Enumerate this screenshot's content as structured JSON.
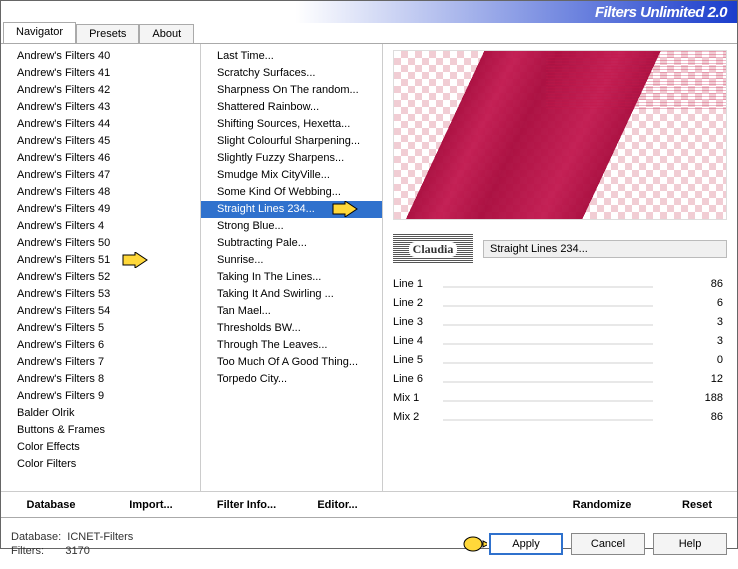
{
  "title": "Filters Unlimited 2.0",
  "tabs": [
    "Navigator",
    "Presets",
    "About"
  ],
  "active_tab": 0,
  "categories": [
    "Andrew's Filters 40",
    "Andrew's Filters 41",
    "Andrew's Filters 42",
    "Andrew's Filters 43",
    "Andrew's Filters 44",
    "Andrew's Filters 45",
    "Andrew's Filters 46",
    "Andrew's Filters 47",
    "Andrew's Filters 48",
    "Andrew's Filters 49",
    "Andrew's Filters 4",
    "Andrew's Filters 50",
    "Andrew's Filters 51",
    "Andrew's Filters 52",
    "Andrew's Filters 53",
    "Andrew's Filters 54",
    "Andrew's Filters 5",
    "Andrew's Filters 6",
    "Andrew's Filters 7",
    "Andrew's Filters 8",
    "Andrew's Filters 9",
    "Balder Olrik",
    "Buttons & Frames",
    "Color Effects",
    "Color Filters"
  ],
  "category_arrow_index": 12,
  "filters": [
    "Last Time...",
    "Scratchy Surfaces...",
    "Sharpness On The random...",
    "Shattered Rainbow...",
    "Shifting Sources, Hexetta...",
    "Slight Colourful Sharpening...",
    "Slightly Fuzzy Sharpens...",
    "Smudge Mix CityVille...",
    "Some Kind Of Webbing...",
    "Straight Lines 234...",
    "Strong Blue...",
    "Subtracting Pale...",
    "Sunrise...",
    "Taking In The Lines...",
    "Taking It And Swirling ...",
    "Tan Mael...",
    "Thresholds BW...",
    "Through The Leaves...",
    "Too Much Of A Good Thing...",
    "Torpedo City..."
  ],
  "filter_selected_index": 9,
  "filter_arrow_index": 9,
  "col_buttons": {
    "database": "Database",
    "import": "Import...",
    "filter_info": "Filter Info...",
    "editor": "Editor..."
  },
  "right_buttons": {
    "randomize": "Randomize",
    "reset": "Reset"
  },
  "selected_filter_title": "Straight Lines 234...",
  "watermark": "Claudia",
  "params": [
    {
      "name": "Line 1",
      "value": 86
    },
    {
      "name": "Line 2",
      "value": 6
    },
    {
      "name": "Line 3",
      "value": 3
    },
    {
      "name": "Line 4",
      "value": 3
    },
    {
      "name": "Line 5",
      "value": 0
    },
    {
      "name": "Line 6",
      "value": 12
    },
    {
      "name": "Mix 1",
      "value": 188
    },
    {
      "name": "Mix 2",
      "value": 86
    }
  ],
  "meta": {
    "db_label": "Database:",
    "db_value": "ICNET-Filters",
    "filters_label": "Filters:",
    "filters_value": "3170"
  },
  "buttons": {
    "apply": "Apply",
    "cancel": "Cancel",
    "help": "Help"
  }
}
